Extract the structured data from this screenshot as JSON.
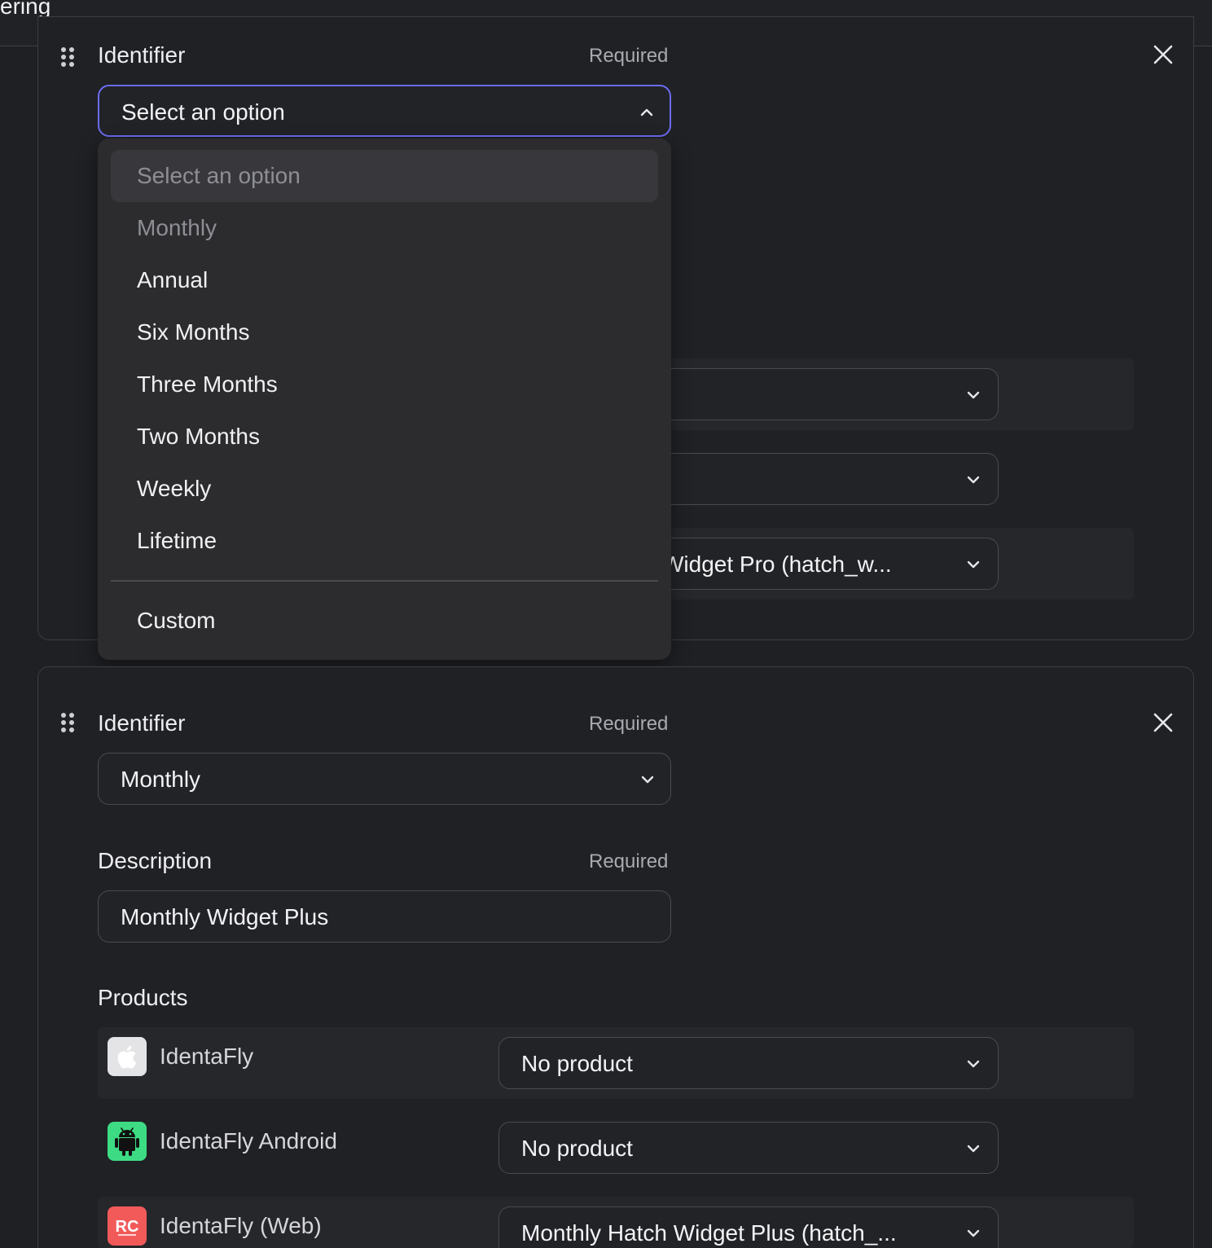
{
  "page": {
    "title_fragment": "ering"
  },
  "card1": {
    "identifier_label": "Identifier",
    "required": "Required",
    "select_value": "Select an option",
    "rows": [
      {
        "value": ""
      },
      {
        "value": ""
      },
      {
        "value": "Widget Pro (hatch_w..."
      }
    ]
  },
  "dropdown": {
    "options": [
      "Select an option",
      "Monthly",
      "Annual",
      "Six Months",
      "Three Months",
      "Two Months",
      "Weekly",
      "Lifetime"
    ],
    "custom": "Custom"
  },
  "card2": {
    "identifier_label": "Identifier",
    "identifier_required": "Required",
    "identifier_value": "Monthly",
    "description_label": "Description",
    "description_required": "Required",
    "description_value": "Monthly Widget Plus",
    "products_label": "Products",
    "products": [
      {
        "icon": "apple-icon",
        "name": "IdentaFly",
        "value": "No product"
      },
      {
        "icon": "android-icon",
        "name": "IdentaFly Android",
        "value": "No product"
      },
      {
        "icon": "revenuecat-icon",
        "name": "IdentaFly (Web)",
        "value": "Monthly Hatch Widget Plus (hatch_..."
      }
    ]
  },
  "colors": {
    "focus_border": "#6b6cf0",
    "apple_bg": "#e8e8ea",
    "android_bg": "#3ddc84",
    "rc_bg": "#f25a5a"
  }
}
